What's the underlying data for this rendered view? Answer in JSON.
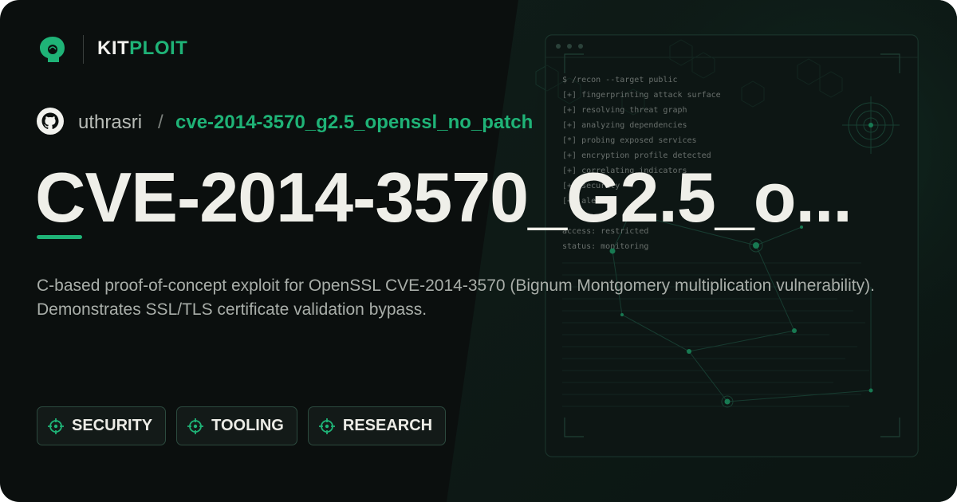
{
  "brand": {
    "name_part1": "KIT",
    "name_part2": "PLOIT"
  },
  "repo": {
    "owner": "uthrasri",
    "separator": "/",
    "name": "cve-2014-3570_g2.5_openssl_no_patch"
  },
  "title": "CVE-2014-3570_G2.5_o...",
  "description": "C-based proof-of-concept exploit for OpenSSL CVE-2014-3570 (Bignum Montgomery multiplication vulnerability). Demonstrates SSL/TLS certificate validation bypass.",
  "tags": [
    {
      "label": "SECURITY",
      "icon": "crosshair-icon"
    },
    {
      "label": "TOOLING",
      "icon": "crosshair-icon"
    },
    {
      "label": "RESEARCH",
      "icon": "crosshair-icon"
    }
  ],
  "terminal": {
    "lines": [
      "$ /recon --target public",
      "[+] fingerprinting attack surface",
      "[+] resolving threat graph",
      "[+] analyzing dependencies",
      "[*] probing exposed services",
      "[+] encryption profile detected",
      "[+] correlating indicators",
      "[+] security",
      "[+] alerts",
      "access: restricted",
      "status: monitoring"
    ]
  },
  "colors": {
    "accent": "#1fb377",
    "background": "#0b0f0e",
    "panel": "#0f1a17"
  },
  "icons": {
    "logo": "kitploit-logo-icon",
    "github": "github-icon"
  }
}
